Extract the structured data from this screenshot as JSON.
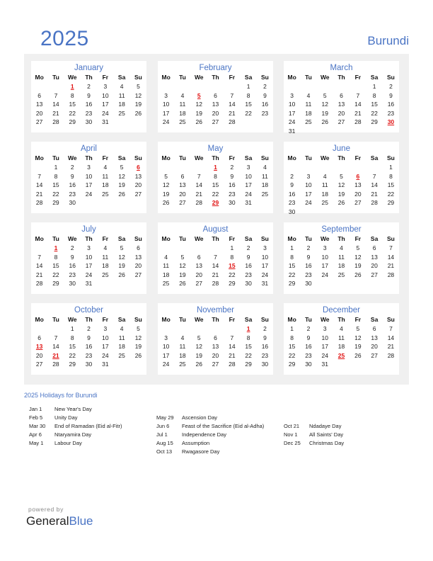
{
  "header": {
    "year": "2025",
    "country": "Burundi"
  },
  "weekday_labels": [
    "Mo",
    "Tu",
    "We",
    "Th",
    "Fr",
    "Sa",
    "Su"
  ],
  "months": [
    {
      "name": "January",
      "offset": 2,
      "days": 31,
      "holidays": [
        1
      ]
    },
    {
      "name": "February",
      "offset": 5,
      "days": 28,
      "holidays": [
        5
      ]
    },
    {
      "name": "March",
      "offset": 5,
      "days": 31,
      "holidays": [
        30
      ]
    },
    {
      "name": "April",
      "offset": 1,
      "days": 30,
      "holidays": [
        6
      ]
    },
    {
      "name": "May",
      "offset": 3,
      "days": 31,
      "holidays": [
        1,
        29
      ]
    },
    {
      "name": "June",
      "offset": 6,
      "days": 30,
      "holidays": [
        6
      ]
    },
    {
      "name": "July",
      "offset": 1,
      "days": 31,
      "holidays": [
        1
      ]
    },
    {
      "name": "August",
      "offset": 4,
      "days": 31,
      "holidays": [
        15
      ]
    },
    {
      "name": "September",
      "offset": 0,
      "days": 30,
      "holidays": []
    },
    {
      "name": "October",
      "offset": 2,
      "days": 31,
      "holidays": [
        13,
        21
      ]
    },
    {
      "name": "November",
      "offset": 5,
      "days": 30,
      "holidays": [
        1
      ]
    },
    {
      "name": "December",
      "offset": 0,
      "days": 31,
      "holidays": [
        25
      ]
    }
  ],
  "holidays_title": "2025 Holidays for Burundi",
  "holiday_columns": [
    [
      {
        "date": "Jan 1",
        "name": "New Year's Day"
      },
      {
        "date": "Feb 5",
        "name": "Unity Day"
      },
      {
        "date": "Mar 30",
        "name": "End of Ramadan (Eid al-Fitr)"
      },
      {
        "date": "Apr 6",
        "name": "Ntaryamira Day"
      },
      {
        "date": "May 1",
        "name": "Labour Day"
      }
    ],
    [
      {
        "date": "May 29",
        "name": "Ascension Day"
      },
      {
        "date": "Jun 6",
        "name": "Feast of the Sacrifice (Eid al-Adha)"
      },
      {
        "date": "Jul 1",
        "name": "Independence Day"
      },
      {
        "date": "Aug 15",
        "name": "Assumption"
      },
      {
        "date": "Oct 13",
        "name": "Rwagasore Day"
      }
    ],
    [
      {
        "date": "Oct 21",
        "name": "Ndadaye Day"
      },
      {
        "date": "Nov 1",
        "name": "All Saints' Day"
      },
      {
        "date": "Dec 25",
        "name": "Christmas Day"
      }
    ]
  ],
  "footer": {
    "powered_by": "powered by",
    "brand_general": "General",
    "brand_blue": "Blue"
  }
}
